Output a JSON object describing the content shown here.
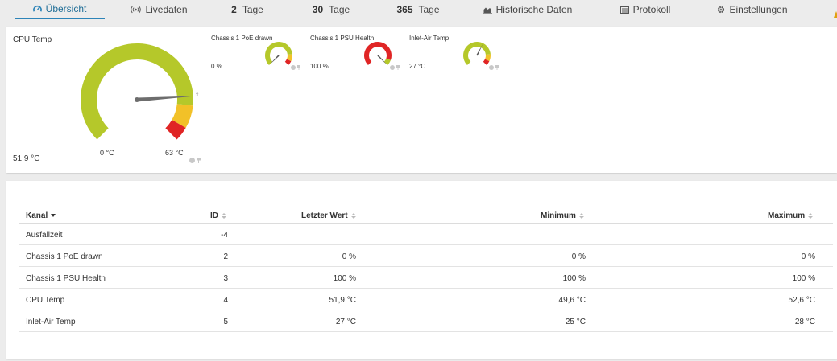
{
  "tabs": [
    {
      "label": "Übersicht",
      "icon": "gauge-icon",
      "active": true
    },
    {
      "label": "Livedaten",
      "icon": "live-signal-icon"
    },
    {
      "num": "2",
      "label": "Tage"
    },
    {
      "num": "30",
      "label": "Tage"
    },
    {
      "num": "365",
      "label": "Tage"
    },
    {
      "label": "Historische Daten",
      "icon": "area-chart-icon"
    },
    {
      "label": "Protokoll",
      "icon": "log-list-icon"
    },
    {
      "label": "Einstellungen",
      "icon": "gear-icon"
    }
  ],
  "gauges": {
    "cpu_temp": {
      "title": "CPU Temp",
      "value": "51,9 °C",
      "min_label": "0 °C",
      "max_label": "63 °C",
      "needle_fraction": 0.82
    },
    "poe": {
      "title": "Chassis 1 PoE drawn",
      "value": "0 %",
      "needle_fraction": 0.0
    },
    "psu": {
      "title": "Chassis 1 PSU Health",
      "value": "100 %",
      "needle_fraction": 1.0
    },
    "inlet": {
      "title": "Inlet-Air Temp",
      "value": "27 °C",
      "needle_fraction": 0.6
    }
  },
  "colors": {
    "ok": "#b5c82a",
    "warning": "#f2c128",
    "error": "#e02525",
    "accent": "#2d84b8"
  },
  "table": {
    "headers": {
      "kanal": "Kanal",
      "id": "ID",
      "letzter_wert": "Letzter Wert",
      "minimum": "Minimum",
      "maximum": "Maximum"
    },
    "rows": [
      {
        "kanal": "Ausfallzeit",
        "id": "-4",
        "letzter_wert": "",
        "minimum": "",
        "maximum": ""
      },
      {
        "kanal": "Chassis 1 PoE drawn",
        "id": "2",
        "letzter_wert": "0 %",
        "minimum": "0 %",
        "maximum": "0 %"
      },
      {
        "kanal": "Chassis 1 PSU Health",
        "id": "3",
        "letzter_wert": "100 %",
        "minimum": "100 %",
        "maximum": "100 %"
      },
      {
        "kanal": "CPU Temp",
        "id": "4",
        "letzter_wert": "51,9 °C",
        "minimum": "49,6 °C",
        "maximum": "52,6 °C"
      },
      {
        "kanal": "Inlet-Air Temp",
        "id": "5",
        "letzter_wert": "27 °C",
        "minimum": "25 °C",
        "maximum": "28 °C"
      }
    ]
  }
}
